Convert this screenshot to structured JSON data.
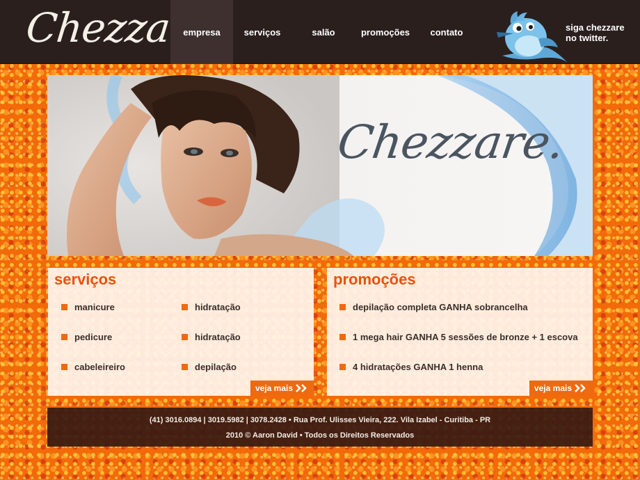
{
  "header": {
    "logo": "Chezzare.",
    "nav": [
      {
        "label": "empresa",
        "active": true
      },
      {
        "label": "serviços",
        "active": false
      },
      {
        "label": "salão",
        "active": false
      },
      {
        "label": "promoções",
        "active": false
      },
      {
        "label": "contato",
        "active": false
      }
    ],
    "twitter_line1": "siga chezzare",
    "twitter_line2": "no twitter.",
    "twitter_icon": "twitter-bird-icon"
  },
  "hero": {
    "logo": "Chezzare."
  },
  "services": {
    "title": "serviços",
    "col1": [
      "manicure",
      "pedicure",
      "cabeleireiro"
    ],
    "col2": [
      "hidratação",
      "hidratação",
      "depilação"
    ],
    "more_label": "veja mais"
  },
  "promotions": {
    "title": "promoções",
    "items": [
      "depilação completa GANHA sobrancelha",
      "1 mega hair GANHA 5 sessões de bronze + 1 escova",
      "4 hidratações GANHA 1 henna"
    ],
    "more_label": "veja mais"
  },
  "footer": {
    "line1": "(41) 3016.0894 | 3019.5982 | 3078.2428 • Rua Prof. Ulisses Vieira, 222. Vila Izabel - Curitiba - PR",
    "line2": "2010 © Aaron David • Todos os Direitos Reservados"
  },
  "colors": {
    "header_bg": "#2b1f1e",
    "accent": "#ee6a10",
    "title": "#e8520a",
    "page_bg": "#f26a0a"
  }
}
